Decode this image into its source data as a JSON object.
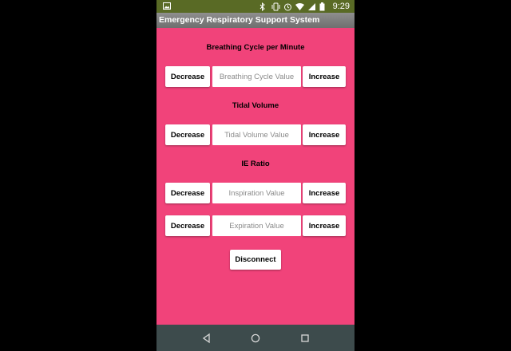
{
  "status_bar": {
    "time": "9:29",
    "icons": [
      "image-icon",
      "bluetooth-icon",
      "vibrate-icon",
      "alarm-icon",
      "wifi-icon",
      "signal-icon",
      "battery-icon"
    ]
  },
  "app": {
    "title": "Emergency Respiratory Support System"
  },
  "breathing": {
    "title": "Breathing Cycle per Minute",
    "decrease_label": "Decrease",
    "placeholder": "Breathing Cycle Value",
    "increase_label": "Increase"
  },
  "tidal": {
    "title": "Tidal Volume",
    "decrease_label": "Decrease",
    "placeholder": "Tidal Volume Value",
    "increase_label": "Increase"
  },
  "ie_ratio": {
    "title": "IE Ratio",
    "inspiration": {
      "decrease_label": "Decrease",
      "placeholder": "Inspiration Value",
      "increase_label": "Increase"
    },
    "expiration": {
      "decrease_label": "Decrease",
      "placeholder": "Expiration Value",
      "increase_label": "Increase"
    }
  },
  "disconnect_label": "Disconnect",
  "nav": {
    "icons": [
      "back-icon",
      "home-icon",
      "recents-icon"
    ]
  },
  "colors": {
    "status_bar": "#596a25",
    "background": "#f1437a",
    "nav_bar": "#3d4b4c"
  }
}
